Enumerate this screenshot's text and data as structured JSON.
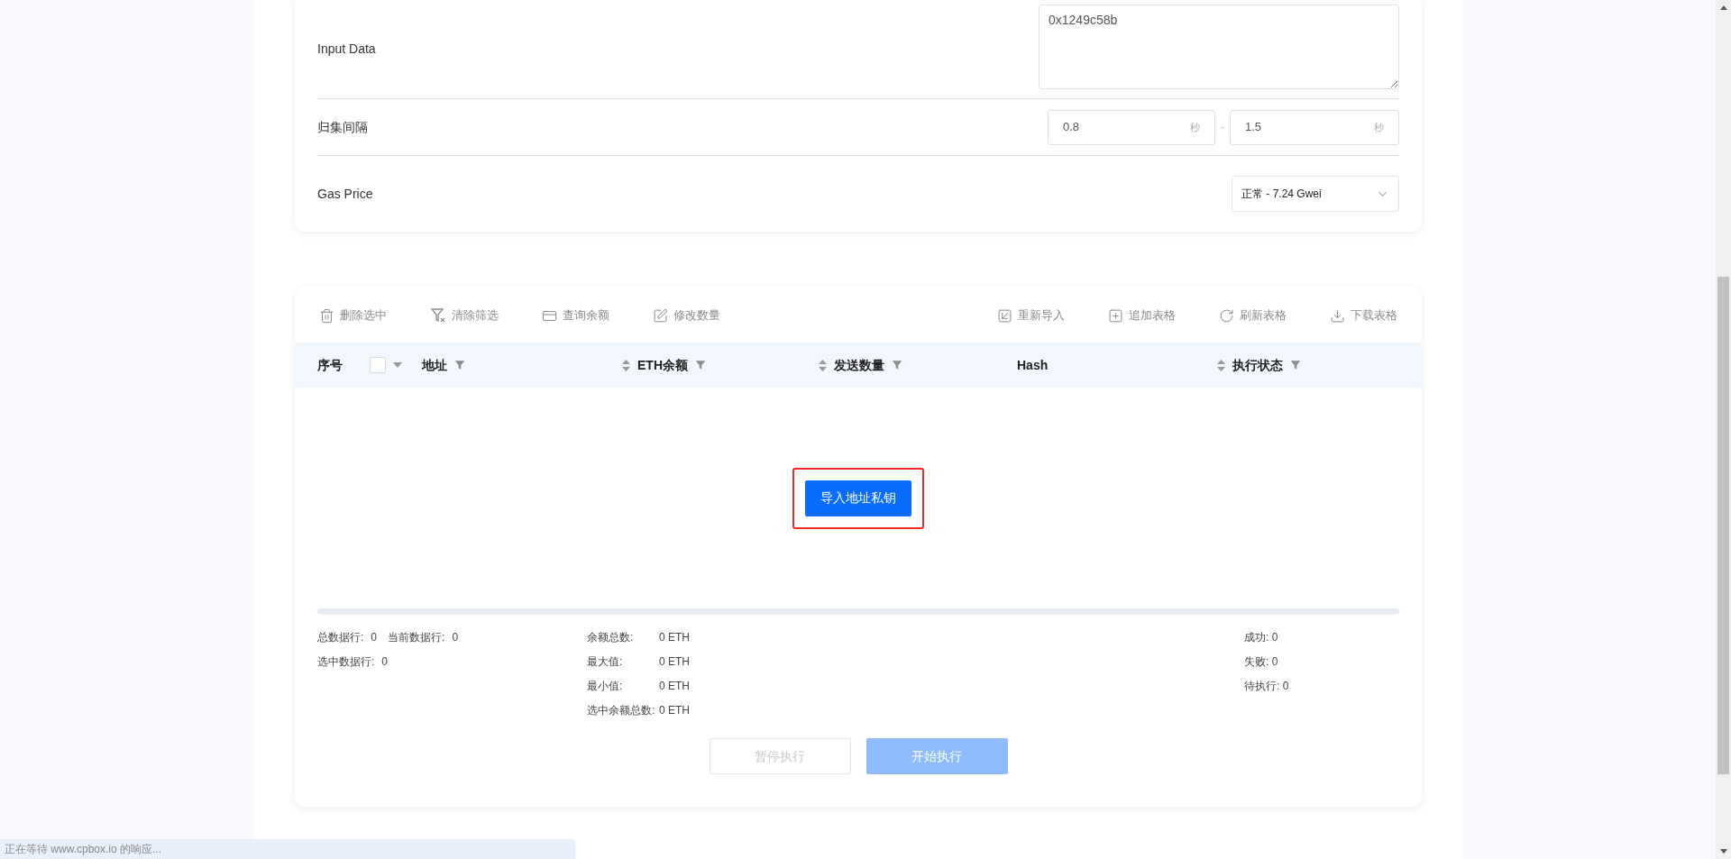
{
  "form": {
    "input_data": {
      "label": "Input Data",
      "value": "0x1249c58b"
    },
    "interval": {
      "label": "归集间隔",
      "min": "0.8",
      "min_unit": "秒",
      "separator": "-",
      "max": "1.5",
      "max_unit": "秒"
    },
    "gas_price": {
      "label": "Gas Price",
      "value": "正常 - 7.24 Gwei"
    }
  },
  "toolbar": {
    "left": [
      {
        "label": "删除选中",
        "kind": "trash"
      },
      {
        "label": "清除筛选",
        "kind": "filter-clear"
      },
      {
        "label": "查询余额",
        "kind": "card-search"
      },
      {
        "label": "修改数量",
        "kind": "edit"
      }
    ],
    "right": [
      {
        "label": "重新导入",
        "kind": "import"
      },
      {
        "label": "追加表格",
        "kind": "add"
      },
      {
        "label": "刷新表格",
        "kind": "refresh"
      },
      {
        "label": "下载表格",
        "kind": "download"
      }
    ]
  },
  "table": {
    "columns": [
      {
        "label": "序号",
        "sortable": false,
        "filterable": false,
        "select_all": true,
        "checked": false
      },
      {
        "label": "地址",
        "sortable": false,
        "filterable": true
      },
      {
        "label": "ETH余额",
        "sortable": true,
        "filterable": true
      },
      {
        "label": "发送数量",
        "sortable": true,
        "filterable": true
      },
      {
        "label": "Hash",
        "sortable": false,
        "filterable": false
      },
      {
        "label": "执行状态",
        "sortable": true,
        "filterable": true
      }
    ],
    "empty_action": {
      "label": "导入地址私钥",
      "highlighted": true
    }
  },
  "stats": {
    "left": [
      [
        {
          "label": "总数据行:",
          "value": "0"
        },
        {
          "label": "当前数据行:",
          "value": "0"
        }
      ],
      [
        {
          "label": "选中数据行:",
          "value": "0"
        }
      ]
    ],
    "middle": [
      {
        "label": "余额总数:",
        "value": "0 ETH"
      },
      {
        "label": "最大值:",
        "value": "0 ETH"
      },
      {
        "label": "最小值:",
        "value": "0 ETH"
      },
      {
        "label": "选中余额总数:",
        "value": "0 ETH"
      }
    ],
    "right": [
      {
        "label": "成功:",
        "value": "0"
      },
      {
        "label": "失败:",
        "value": "0"
      },
      {
        "label": "待执行:",
        "value": "0"
      }
    ]
  },
  "buttons": [
    {
      "label": "暂停执行",
      "kind": "secondary",
      "disabled": true
    },
    {
      "label": "开始执行",
      "kind": "primary",
      "disabled": true
    }
  ],
  "status_bar": "正在等待 www.cpbox.io 的响应..."
}
